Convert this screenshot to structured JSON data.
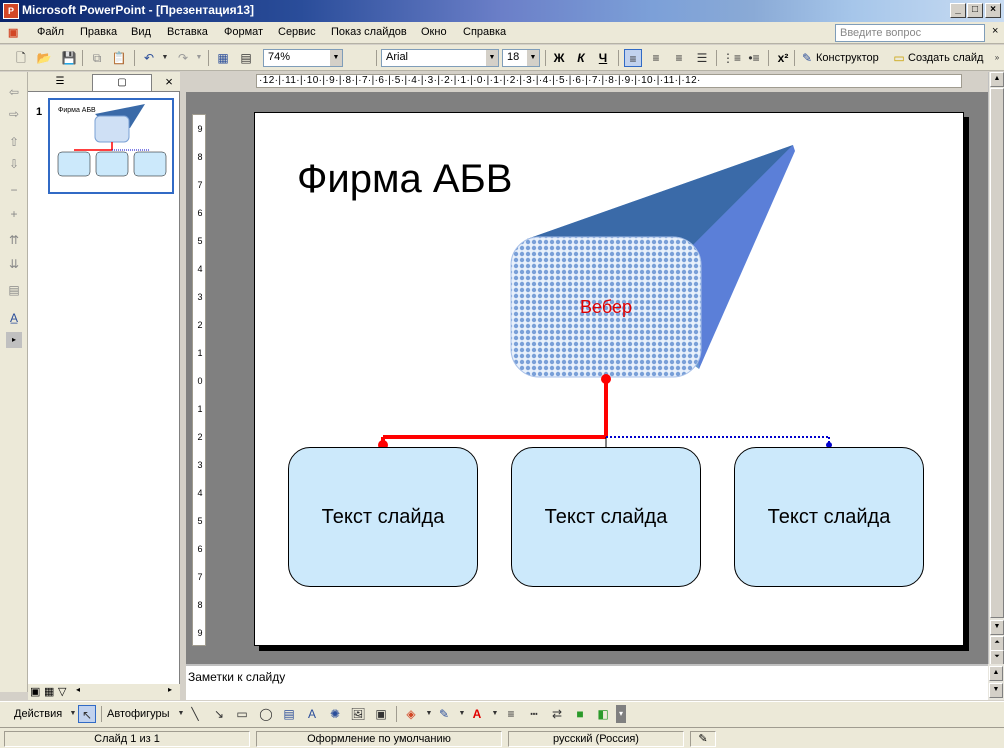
{
  "app": {
    "title": "Microsoft PowerPoint - [Презентация13]",
    "help_placeholder": "Введите вопрос"
  },
  "menu": {
    "items": [
      "Файл",
      "Правка",
      "Вид",
      "Вставка",
      "Формат",
      "Сервис",
      "Показ слайдов",
      "Окно",
      "Справка"
    ]
  },
  "toolbar": {
    "zoom": "74%",
    "font": "Arial",
    "font_size": "18",
    "bold": "Ж",
    "italic": "К",
    "underline": "Ч",
    "superscript": "x²",
    "designer_label": "Конструктор",
    "new_slide_label": "Создать слайд"
  },
  "ruler": {
    "horizontal": "·12·|·11·|·10·|·9·|·8·|·7·|·6·|·5·|·4·|·3·|·2·|·1·|·0·|·1·|·2·|·3·|·4·|·5·|·6·|·7·|·8·|·9·|·10·|·11·|·12·",
    "vertical": [
      "9",
      "8",
      "7",
      "6",
      "5",
      "4",
      "3",
      "2",
      "1",
      "0",
      "1",
      "2",
      "3",
      "4",
      "5",
      "6",
      "7",
      "8",
      "9"
    ]
  },
  "slides_pane": {
    "slide_number": "1",
    "thumb_title": "Фирма АБВ"
  },
  "slide": {
    "title": "Фирма АБВ",
    "center_box": "Вебер",
    "boxes": [
      "Текст слайда",
      "Текст слайда",
      "Текст слайда"
    ]
  },
  "notes": {
    "placeholder": "Заметки к слайду"
  },
  "drawing": {
    "actions_label": "Действия",
    "autoshapes_label": "Автофигуры"
  },
  "status": {
    "slide_info": "Слайд 1 из 1",
    "design": "Оформление по умолчанию",
    "language": "русский (Россия)"
  },
  "colors": {
    "titlebar": "#0a246a",
    "box_fill": "#cce9fb",
    "connector": "#ff0000",
    "dotted": "#0000cc",
    "accent": "#e00000",
    "extrusion": "#3a6aa8"
  }
}
